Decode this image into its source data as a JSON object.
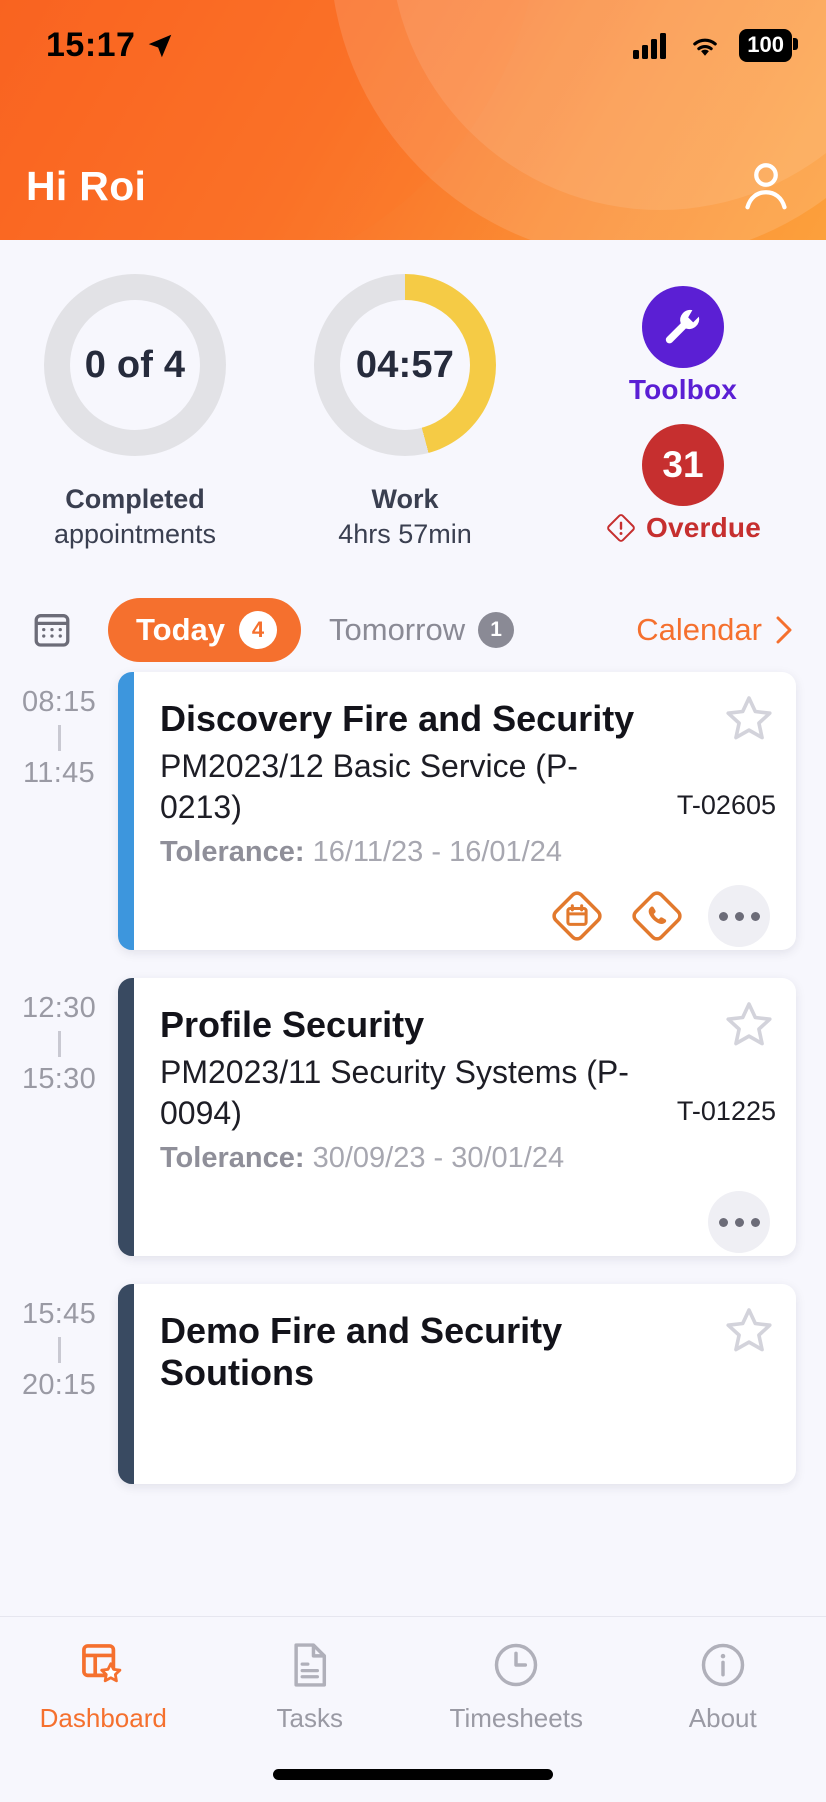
{
  "statusbar": {
    "time": "15:17",
    "location_icon": "location-arrow-icon",
    "signal_icon": "cellular-signal-icon",
    "wifi_icon": "wifi-icon",
    "battery": "100"
  },
  "header": {
    "greeting": "Hi Roi",
    "profile_icon": "person-icon",
    "accent_color": "#f5702e"
  },
  "stats": {
    "completed": {
      "value": "0 of 4",
      "label_line1": "Completed",
      "label_line2": "appointments",
      "progress_pct": 0
    },
    "work": {
      "value": "04:57",
      "label_line1": "Work",
      "label_line2": "4hrs 57min",
      "progress_pct": 46,
      "arc_color": "#f5cb45"
    },
    "toolbox": {
      "label": "Toolbox",
      "icon": "wrench-icon",
      "color": "#5b1fd4"
    },
    "overdue": {
      "count": "31",
      "label": "Overdue",
      "icon": "warning-diamond-icon",
      "color": "#c62f2f"
    }
  },
  "tabs": {
    "calendar_grid_icon": "calendar-grid-icon",
    "items": [
      {
        "label": "Today",
        "badge": "4",
        "active": true
      },
      {
        "label": "Tomorrow",
        "badge": "1",
        "active": false
      }
    ],
    "calendar_link": "Calendar",
    "chevron_icon": "chevron-right-icon"
  },
  "appointments": [
    {
      "start": "08:15",
      "end": "11:45",
      "accent": "#3d96dd",
      "title": "Discovery Fire and Security",
      "subtitle": "PM2023/12 Basic Service (P-0213)",
      "tolerance_label": "Tolerance:",
      "tolerance_value": "16/11/23 - 16/01/24",
      "ticket": "T-02605",
      "star_icon": "star-outline-icon",
      "actions": [
        "calendar-diamond-icon",
        "phone-diamond-icon",
        "more-options-icon"
      ]
    },
    {
      "start": "12:30",
      "end": "15:30",
      "accent": "#394a61",
      "title": "Profile Security",
      "subtitle": "PM2023/11 Security Systems (P-0094)",
      "tolerance_label": "Tolerance:",
      "tolerance_value": "30/09/23 - 30/01/24",
      "ticket": "T-01225",
      "star_icon": "star-outline-icon",
      "actions": [
        "more-options-icon"
      ]
    },
    {
      "start": "15:45",
      "end": "20:15",
      "accent": "#394a61",
      "title": "Demo Fire and Security Soutions",
      "subtitle": "",
      "tolerance_label": "",
      "tolerance_value": "",
      "ticket": "",
      "star_icon": "star-outline-icon",
      "actions": []
    }
  ],
  "bottomnav": {
    "items": [
      {
        "label": "Dashboard",
        "icon": "dashboard-star-icon",
        "active": true
      },
      {
        "label": "Tasks",
        "icon": "document-lines-icon",
        "active": false
      },
      {
        "label": "Timesheets",
        "icon": "clock-icon",
        "active": false
      },
      {
        "label": "About",
        "icon": "info-circle-icon",
        "active": false
      }
    ],
    "active_color": "#f5702e",
    "inactive_color": "#9a9aa4"
  }
}
